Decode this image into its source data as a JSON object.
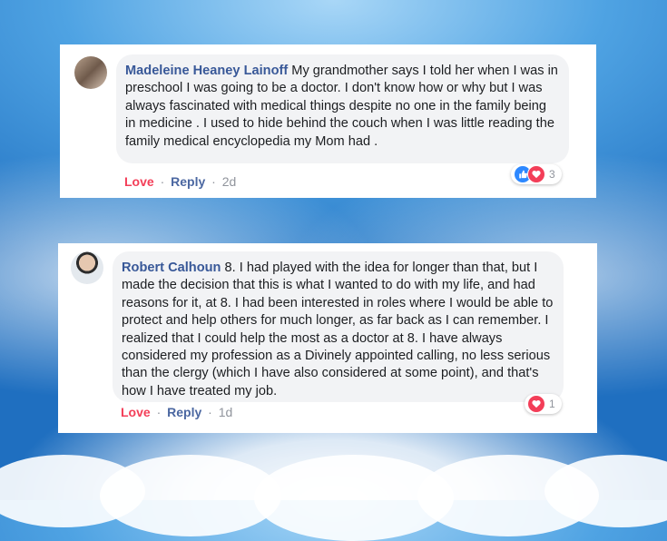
{
  "comments": [
    {
      "author": "Madeleine Heaney Lainoff",
      "text": "My grandmother says I told her when I was in preschool I was going to be a doctor. I don't know how or why but I was always fascinated with medical things despite no one in the family being in medicine . I used to hide behind the couch when I was little reading the family medical encyclopedia my Mom had .",
      "reaction_count": "3",
      "reaction_icons": [
        "like-icon",
        "love-icon"
      ],
      "love_label": "Love",
      "reply_label": "Reply",
      "time": "2d"
    },
    {
      "author": "Robert Calhoun",
      "text": "8. I had played with the idea for longer than that, but I made the decision that this is what I wanted to do with my life, and had reasons for it, at 8. I had been interested in roles where I would be able to protect and help others for much longer, as far back as I can remember. I realized that I could help the most as a doctor at 8. I have always considered my profession as a Divinely appointed calling, no less serious than the clergy (which I have also considered at some point), and that's how I have treated my job.",
      "reaction_count": "1",
      "reaction_icons": [
        "love-icon"
      ],
      "love_label": "Love",
      "reply_label": "Reply",
      "time": "1d"
    }
  ],
  "separator": "·",
  "colors": {
    "author": "#385898",
    "love": "#f33e58",
    "reply": "#4b67a1",
    "bubble": "#f2f3f5",
    "like_reaction": "#2d88ff"
  }
}
